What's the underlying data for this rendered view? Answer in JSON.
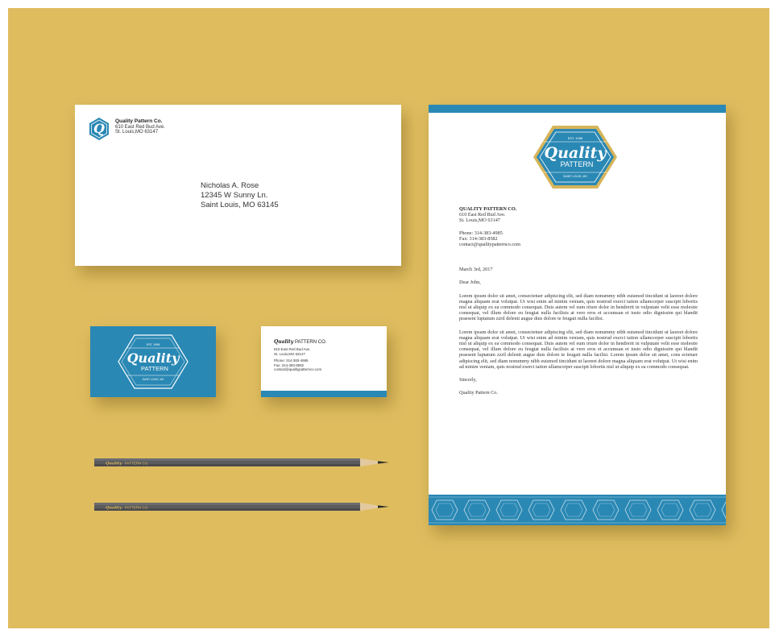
{
  "colors": {
    "background": "#dfbd5f",
    "brand_blue": "#2a88b4",
    "gold": "#d6b45a"
  },
  "logo": {
    "script_word": "Quality",
    "word": "PATTERN",
    "est": "EST. 1998",
    "city": "SAINT LOUIS, MO",
    "initial": "Q"
  },
  "envelope": {
    "return_company": "Quality Pattern Co.",
    "return_street": "610 East Red Bud Ave.",
    "return_city": "St. Louis,MO 63147",
    "recipient_name": "Nicholas A. Rose",
    "recipient_street": "12345 W Sunny Ln.",
    "recipient_city": "Saint Louis, MO 63145"
  },
  "letterhead": {
    "company": "QUALITY PATTERN CO.",
    "street": "610 East Red Bud Ave.",
    "city": "St. Louis,MO 63147",
    "phone": "Phone: 314-383-4985",
    "fax": "Fax: 314-383-8582",
    "email": "contact@qualitypatternco.com",
    "date": "March 3rd, 2017",
    "greeting": "Dear John,",
    "paragraph1": "Lorem ipsum dolor sit amet, consectetuer adipiscing elit, sed diam nonummy nibh euismod tincidunt ut laoreet dolore magna aliquam erat volutpat. Ut wisi enim ad minim veniam, quis nostrud exerci tation ullamcorper suscipit lobortis nisl ut aliquip ex ea commodo consequat. Duis autem vel eum iriure dolor in hendrerit in vulputate velit esse molestie consequat, vel illum dolore eu feugiat nulla facilisis at vero eros et accumsan et iusto odio dignissim qui blandit praesent luptatum zzril delenit augue duis dolore te feugait nulla facilisi.",
    "paragraph2": "Lorem ipsum dolor sit amet, consectetuer adipiscing elit, sed diam nonummy nibh euismod tincidunt ut laoreet dolore magna aliquam erat volutpat. Ut wisi enim ad minim veniam, quis nostrud exerci tation ullamcorper suscipit lobortis nisl ut aliquip ex ea commodo consequat. Duis autem vel eum iriure dolor in hendrerit in vulputate velit esse molestie consequat, vel illum dolore eu feugiat nulla facilisis at vero eros et accumsan et iusto odio dignissim qui blandit praesent luptatum zzril delenit augue duis dolore te feugait nulla facilisi. Lorem ipsum dolor sit amet, cons ectetuer adipiscing elit, sed diam nonummy nibh euismod tincidunt ut laoreet dolore magna aliquam erat volutpat. Ut wisi enim ad minim veniam, quis nostrud exerci tation ullamcorper suscipit lobortis nisl ut aliquip ex ea commodo consequat.",
    "closing": "Sincerly,",
    "signature": "Quality Pattern Co."
  },
  "business_card": {
    "company_script": "Quality",
    "company_rest": " PATTERN CO.",
    "street": "610 East Red Bud Ave.",
    "city": "St. Louis,MO 63147",
    "phone": "Phone: 314-383-4985",
    "fax": "Fax: 314-383-8582",
    "email": "contact@qualitypatternco.com"
  },
  "pencil": {
    "script": "Quality",
    "rest": "PATTERN CO."
  }
}
